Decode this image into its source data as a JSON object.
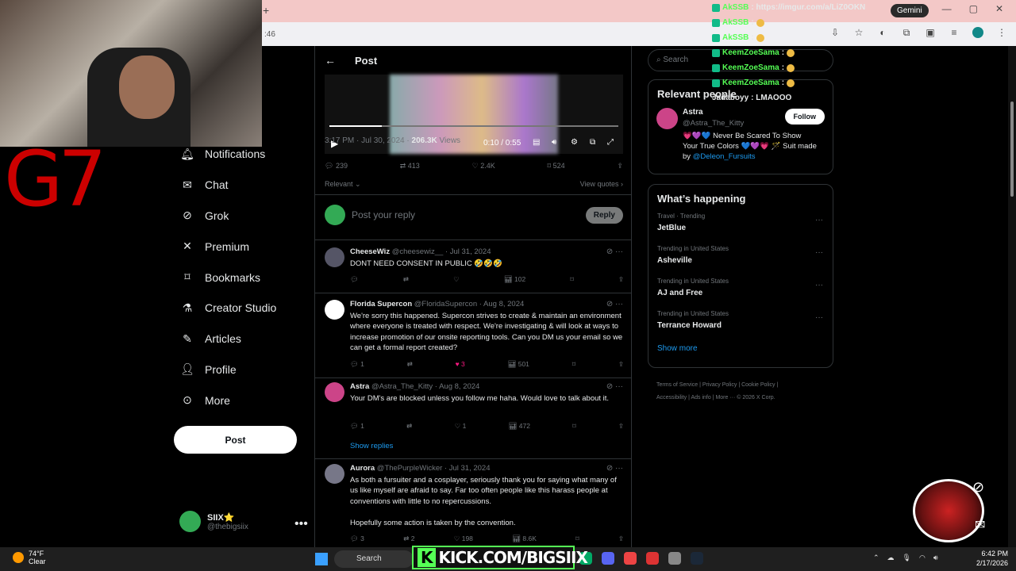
{
  "browser": {
    "tab_number": ":46",
    "gemini_label": "Gemini",
    "new_tab_label": "+"
  },
  "stream_overlay": {
    "logo_text": "G7",
    "kick_label": "KICK.COM/BIGSIIX",
    "kick_k": "K",
    "chat": [
      {
        "user": "AkSSB",
        "message": ": https://imgur.com/a/LiZ0OKN"
      },
      {
        "user": "AkSSB",
        "message": ":"
      },
      {
        "user": "AkSSB",
        "message": ":"
      },
      {
        "user": "KeemZoeSama",
        "message": ":"
      },
      {
        "user": "KeemZoeSama",
        "message": ":"
      },
      {
        "user": "KeemZoeSama",
        "message": ":"
      },
      {
        "user": "Jadaboyy",
        "message": ": LMAOOO"
      }
    ]
  },
  "sidebar": {
    "items": [
      {
        "label": "Notifications",
        "icon": "bell-icon"
      },
      {
        "label": "Chat",
        "icon": "mail-icon"
      },
      {
        "label": "Grok",
        "icon": "grok-icon"
      },
      {
        "label": "Premium",
        "icon": "x-icon"
      },
      {
        "label": "Bookmarks",
        "icon": "bookmark-icon"
      },
      {
        "label": "Creator Studio",
        "icon": "flask-icon"
      },
      {
        "label": "Articles",
        "icon": "article-icon"
      },
      {
        "label": "Profile",
        "icon": "person-icon"
      },
      {
        "label": "More",
        "icon": "more-circle-icon"
      }
    ],
    "post_button": "Post",
    "user": {
      "name": "SIIX⭐",
      "handle": "@thebigsiix",
      "more": "•••"
    }
  },
  "post": {
    "header": "Post",
    "video_time": "0:10 / 0:55",
    "video_progress": 0.18,
    "timestamp": "3:17 PM · Jul 30, 2024 · ",
    "views_count": "206.3K",
    "views_label": " Views",
    "stats": {
      "replies": "239",
      "reposts": "413",
      "likes": "2.4K",
      "bookmarks": "524"
    },
    "sort_label": "Relevant ⌄",
    "view_quotes": "View quotes ›",
    "reply_placeholder": "Post your reply",
    "reply_button": "Reply"
  },
  "replies": [
    {
      "name": "CheeseWiz",
      "handle": "@cheesewiz__",
      "date": " · Jul 31, 2024",
      "text": "DONT NEED CONSENT IN PUBLIC 🤣🤣🤣",
      "replies": "",
      "reposts": "",
      "likes": "",
      "views": "102",
      "avatar_color": "#556"
    },
    {
      "name": "Florida Supercon",
      "handle": "@FloridaSupercon",
      "date": " · Aug 8, 2024",
      "text": "We're sorry this happened. Supercon strives to create & maintain an environment where everyone is treated with respect. We're investigating & will look at ways to increase promotion of our onsite reporting tools. Can you DM us your email so we can get a formal report created?",
      "replies": "1",
      "reposts": "",
      "likes": "3",
      "views": "501",
      "avatar_color": "#fff"
    },
    {
      "name": "Astra",
      "handle": "@Astra_The_Kitty",
      "date": " · Aug 8, 2024",
      "text": "Your DM's are blocked unless you follow me haha. Would love to talk about it.",
      "replies": "1",
      "reposts": "",
      "likes": "1",
      "views": "472",
      "avatar_color": "#c48",
      "show_replies": "Show replies"
    },
    {
      "name": "Aurora",
      "handle": "@ThePurpleWicker",
      "date": " · Jul 31, 2024",
      "text": "As both a fursuiter and a cosplayer, seriously thank you for saying what many of us like myself are afraid to say. Far too often people like this harass people at conventions with little to no repercussions.",
      "text2": "Hopefully some action is taken by the convention.",
      "replies": "3",
      "reposts": "2",
      "likes": "198",
      "views": "8.6K",
      "avatar_color": "#778"
    }
  ],
  "right_sidebar": {
    "search_placeholder": "Search",
    "relevant_title": "Relevant people",
    "person": {
      "name": "Astra",
      "handle": "@Astra_The_Kitty",
      "follow": "Follow",
      "bio": "💗💜💙 Never Be Scared To Show Your True Colors 💙💜💗 🪄 Suit made by ",
      "bio_link": "@Deleon_Fursuits"
    },
    "happening_title": "What’s happening",
    "trends": [
      {
        "category": "Travel · Trending",
        "name": "JetBlue"
      },
      {
        "category": "Trending in United States",
        "name": "Asheville"
      },
      {
        "category": "Trending in United States",
        "name": "AJ and Free"
      },
      {
        "category": "Trending in United States",
        "name": "Terrance Howard"
      }
    ],
    "show_more": "Show more",
    "footer_line1": "Terms of Service  |  Privacy Policy  |  Cookie Policy  |",
    "footer_line2": "Accessibility  |  Ads info  |  More ···  © 2026 X Corp."
  },
  "taskbar": {
    "temp": "74°F",
    "weather": "Clear",
    "search": "Search",
    "time": "6:42 PM",
    "date": "2/17/2026"
  },
  "colors": {
    "accent": "#1d9bf0",
    "like": "#f91880",
    "kick": "#53fc18"
  }
}
